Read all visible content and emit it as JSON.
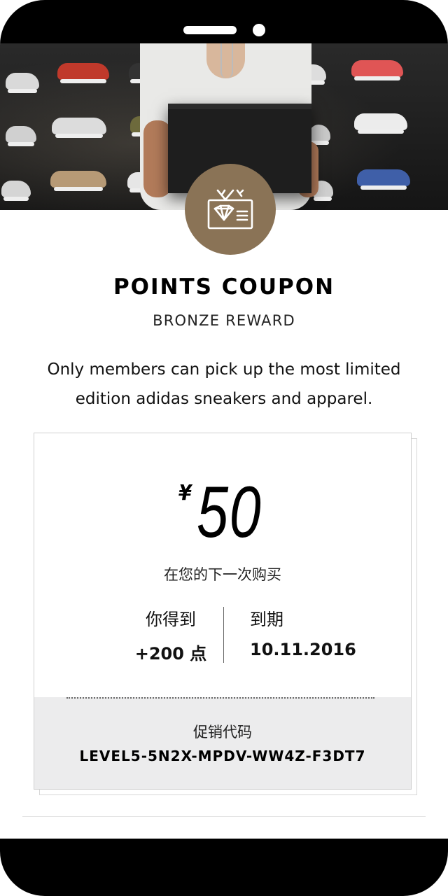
{
  "coupon": {
    "title": "POINTS COUPON",
    "subtitle": "BRONZE REWARD",
    "description": "Only members can pick up the most limited edition adidas sneakers and apparel.",
    "currency_symbol": "¥",
    "amount": "50",
    "applies_to": "在您的下一次购买",
    "points_label": "你得到",
    "points_value": "+200 点",
    "expiry_label": "到期",
    "expiry_value": "10.11.2016",
    "promo_label": "促销代码",
    "promo_code": "LEVEL5-5N2X-MPDV-WW4Z-F3DT7"
  },
  "badge": {
    "icon": "membership-card-icon",
    "color": "#8a7356"
  },
  "hero": {
    "icon": "hero-photo"
  }
}
